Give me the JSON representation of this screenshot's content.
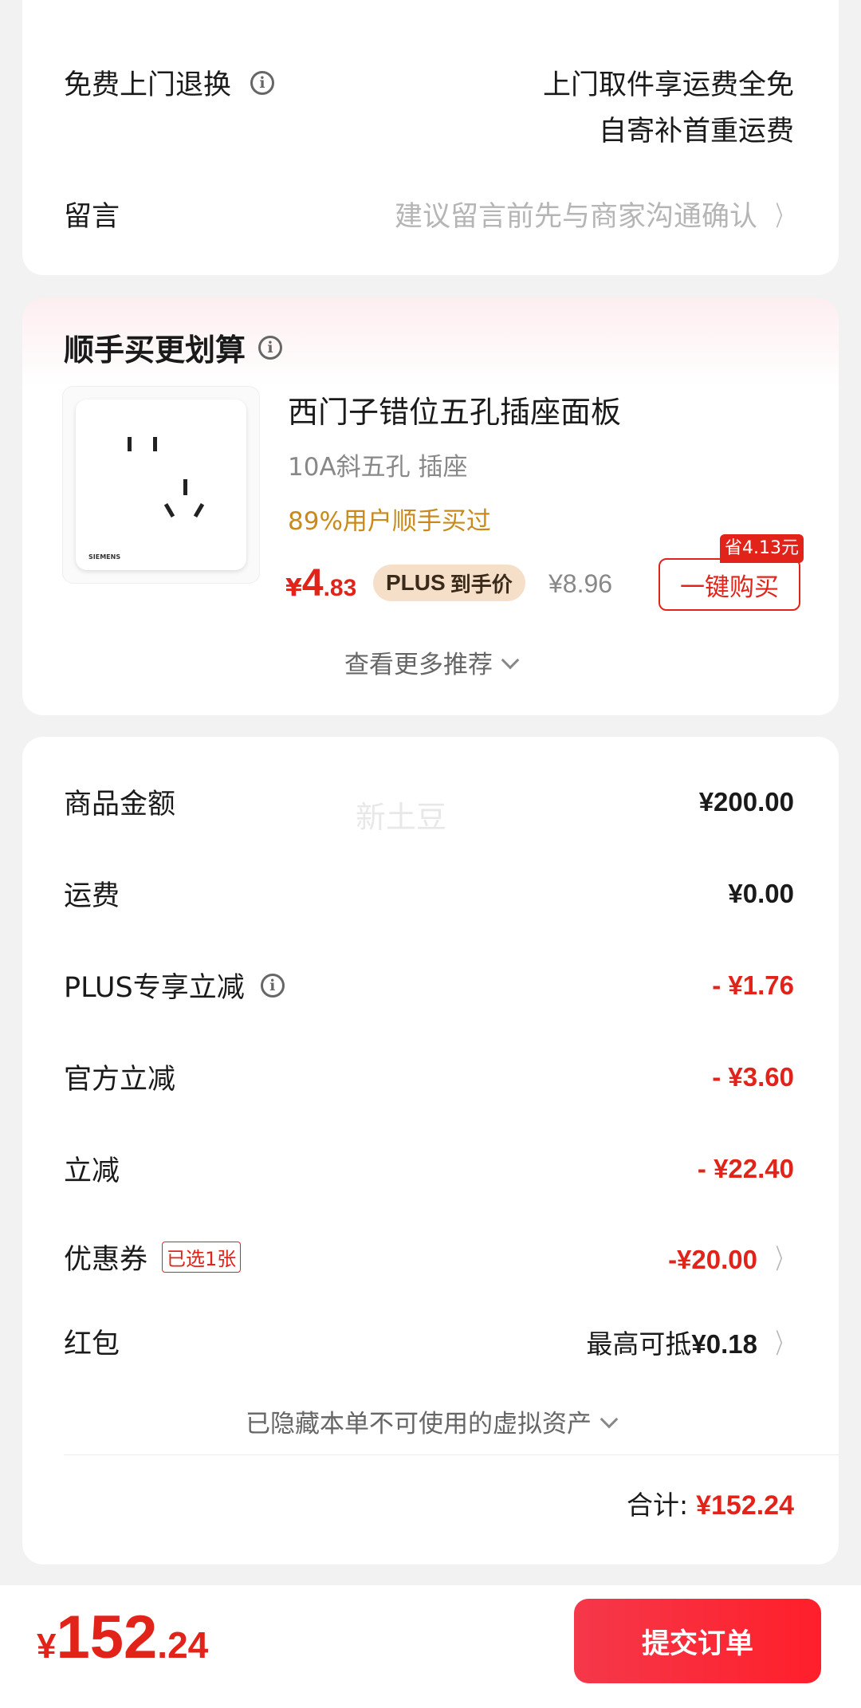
{
  "top_card": {
    "free_return_label": "免费上门退换",
    "free_return_value_line1": "上门取件享运费全免",
    "free_return_value_line2": "自寄补首重运费",
    "message_label": "留言",
    "message_placeholder": "建议留言前先与商家沟通确认"
  },
  "recommend": {
    "title": "顺手买更划算",
    "product_name": "西门子错位五孔插座面板",
    "product_spec": "10A斜五孔 插座",
    "buy_rate": "89%用户顺手买过",
    "brand_text": "SIEMENS",
    "price_symbol": "¥",
    "price_int": "4",
    "price_dec": ".83",
    "plus_badge_bold": "PLUS",
    "plus_badge_text": "到手价",
    "original_price": "¥8.96",
    "save_badge": "省4.13元",
    "buy_button": "一键购买",
    "more_link": "查看更多推荐"
  },
  "summary": {
    "watermark": "新土豆",
    "rows": [
      {
        "label": "商品金额",
        "value": "¥200.00"
      },
      {
        "label": "运费",
        "value": "¥0.00"
      },
      {
        "label": "PLUS专享立减",
        "value": "- ¥1.76"
      },
      {
        "label": "官方立减",
        "value": "- ¥3.60"
      },
      {
        "label": "立减",
        "value": "- ¥22.40"
      },
      {
        "label": "优惠券",
        "tag": "已选1张",
        "value": "-¥20.00"
      },
      {
        "label": "红包",
        "value_prefix": "最高可抵",
        "value": "¥0.18"
      }
    ],
    "hidden_assets": "已隐藏本单不可使用的虚拟资产",
    "total_label": "合计:",
    "total_value": "¥152.24"
  },
  "bottom_bar": {
    "currency": "¥",
    "amount_int": "152",
    "amount_dec": ".24",
    "submit_label": "提交订单"
  },
  "colors": {
    "accent": "#e2231a",
    "gold": "#c98a1a",
    "plus_badge_bg": "#f6dfc8"
  }
}
